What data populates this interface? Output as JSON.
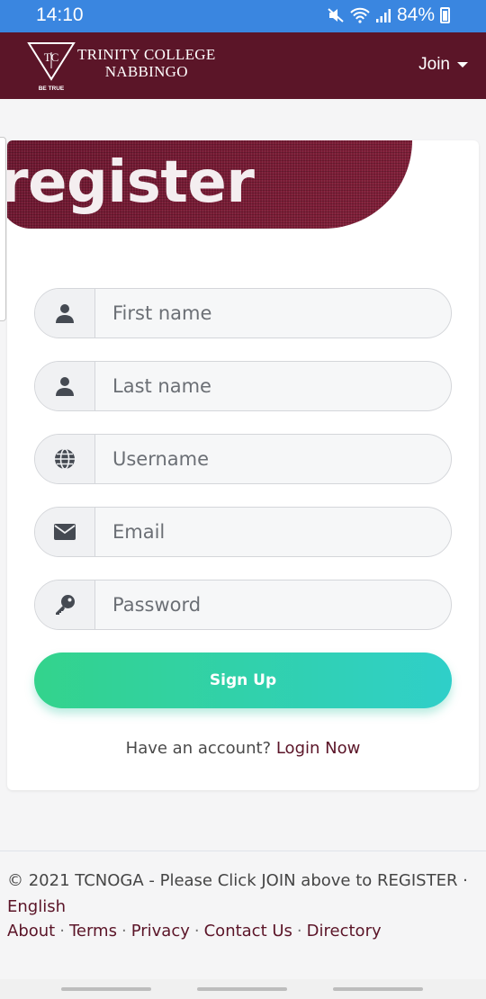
{
  "status": {
    "time": "14:10",
    "battery": "84%"
  },
  "header": {
    "brand_line1": "TRINITY COLLEGE",
    "brand_line2": "NABBINGO",
    "logo_tagline": "BE TRUE",
    "join_label": "Join"
  },
  "card": {
    "title": "register"
  },
  "form": {
    "first_name_placeholder": "First name",
    "last_name_placeholder": "Last name",
    "username_placeholder": "Username",
    "email_placeholder": "Email",
    "password_placeholder": "Password",
    "submit_label": "Sign Up",
    "have_account_text": "Have an account?",
    "login_link": "Login Now"
  },
  "footer": {
    "copyright": "© 2021 TCNOGA - Please Click JOIN above to REGISTER ·",
    "language": "English",
    "links": [
      "About",
      "Terms",
      "Privacy",
      "Contact Us",
      "Directory"
    ]
  },
  "colors": {
    "brand": "#5b1528",
    "status_bar": "#3a86e0",
    "button_start": "#33d38c",
    "button_end": "#2fcfc9"
  }
}
